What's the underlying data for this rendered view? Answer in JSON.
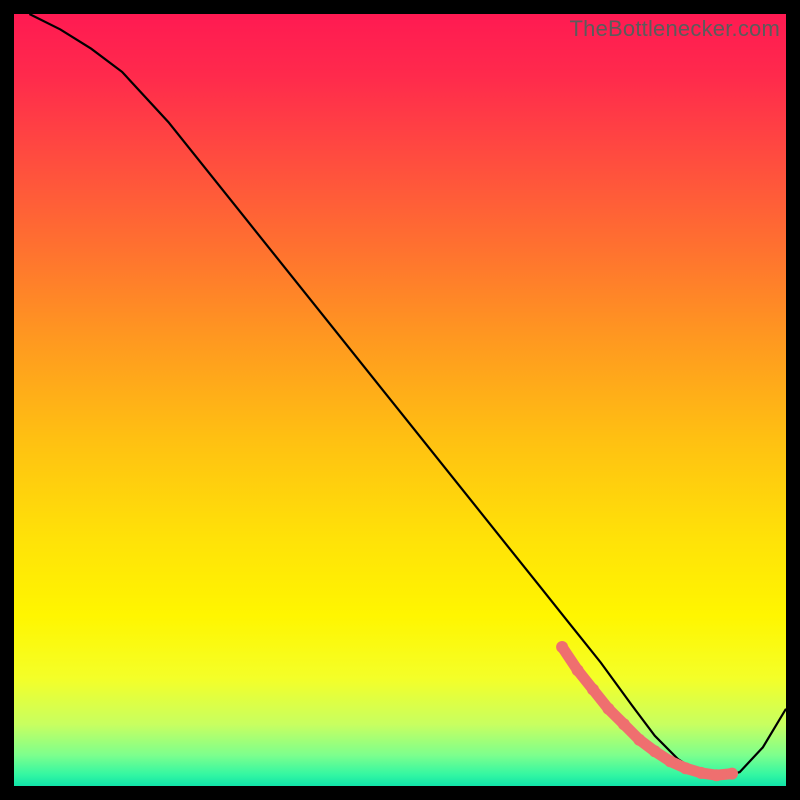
{
  "watermark": "TheBottlenecker.com",
  "colors": {
    "frame": "#000000",
    "curve": "#000000",
    "dot_fill": "#ef6f6f",
    "dot_stroke": "#ef6f6f",
    "gradient_stops": [
      {
        "offset": 0.0,
        "color": "#ff1a52"
      },
      {
        "offset": 0.08,
        "color": "#ff2a4c"
      },
      {
        "offset": 0.18,
        "color": "#ff4a40"
      },
      {
        "offset": 0.3,
        "color": "#ff7030"
      },
      {
        "offset": 0.42,
        "color": "#ff9820"
      },
      {
        "offset": 0.55,
        "color": "#ffc012"
      },
      {
        "offset": 0.68,
        "color": "#ffe208"
      },
      {
        "offset": 0.78,
        "color": "#fff600"
      },
      {
        "offset": 0.86,
        "color": "#f4ff28"
      },
      {
        "offset": 0.92,
        "color": "#c8ff60"
      },
      {
        "offset": 0.96,
        "color": "#7dff8d"
      },
      {
        "offset": 0.985,
        "color": "#34f7a2"
      },
      {
        "offset": 1.0,
        "color": "#10e3a8"
      }
    ]
  },
  "chart_data": {
    "type": "line",
    "title": "",
    "xlabel": "",
    "ylabel": "",
    "xlim": [
      0,
      100
    ],
    "ylim": [
      0,
      100
    ],
    "series": [
      {
        "name": "curve",
        "x": [
          2,
          6,
          10,
          14,
          20,
          30,
          40,
          50,
          60,
          68,
          72,
          76,
          80,
          83,
          86,
          88,
          90,
          92,
          94,
          97,
          100
        ],
        "y": [
          100,
          98,
          95.5,
          92.5,
          86,
          73.5,
          61,
          48.5,
          36,
          26,
          21,
          16,
          10.5,
          6.5,
          3.5,
          2.2,
          1.5,
          1.3,
          1.8,
          5,
          10
        ]
      }
    ],
    "dots": {
      "name": "flat-region",
      "x": [
        71,
        73,
        75,
        77,
        79,
        81,
        83,
        85,
        87,
        89,
        91,
        93
      ],
      "y": [
        18,
        15,
        12.5,
        10,
        8,
        6,
        4.5,
        3.2,
        2.3,
        1.7,
        1.4,
        1.6
      ]
    }
  }
}
